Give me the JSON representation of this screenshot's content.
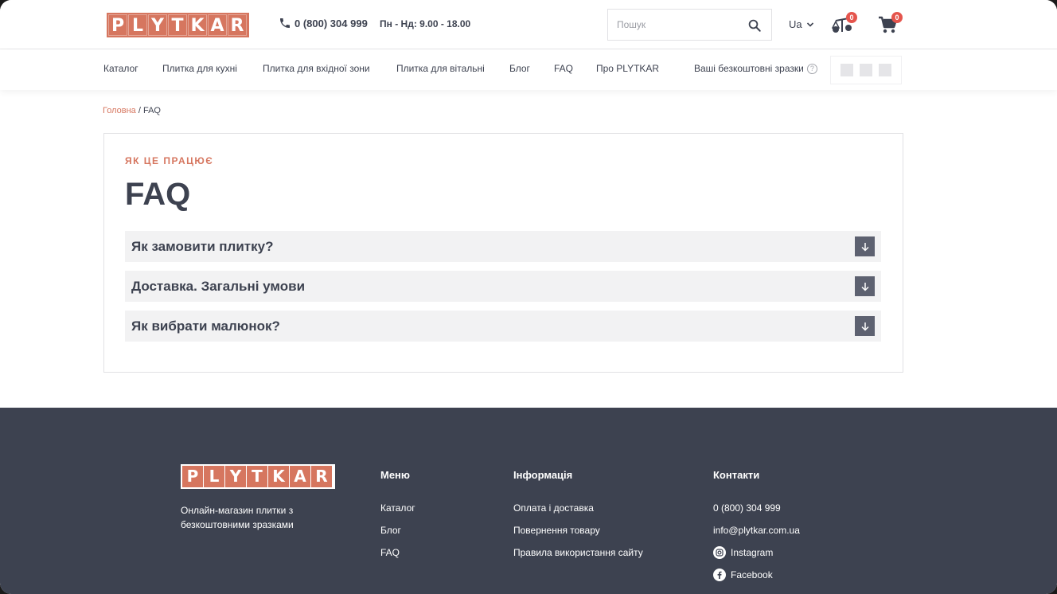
{
  "header": {
    "logo_letters": [
      "P",
      "L",
      "Y",
      "T",
      "K",
      "A",
      "R"
    ],
    "phone": "0 (800) 304 999",
    "hours": "Пн - Нд: 9.00 - 18.00",
    "search_placeholder": "Пошук",
    "lang": "Ua",
    "compare_count": "0",
    "cart_count": "0"
  },
  "nav": {
    "items": [
      "Каталог",
      "Плитка для кухні",
      "Плитка для вхідної зони",
      "Плитка для вітальні",
      "Блог",
      "FAQ",
      "Про PLYTKAR"
    ],
    "samples_label": "Ваші безкоштовні зразки",
    "help_glyph": "?"
  },
  "breadcrumb": {
    "home": "Головна",
    "separator": "/",
    "current": "FAQ"
  },
  "faq": {
    "eyebrow": "ЯК ЦЕ ПРАЦЮЄ",
    "title": "FAQ",
    "questions": [
      "Як замовити плитку?",
      "Доставка. Загальні умови",
      "Як вибрати малюнок?"
    ]
  },
  "footer": {
    "tagline": "Онлайн-магазин плитки з безкоштовними зразками",
    "menu": {
      "heading": "Меню",
      "links": [
        "Каталог",
        "Блог",
        "FAQ"
      ]
    },
    "info": {
      "heading": "Інформація",
      "links": [
        "Оплата і доставка",
        "Повернення товару",
        "Правила використання сайту"
      ]
    },
    "contacts": {
      "heading": "Контакти",
      "phone": "0 (800) 304 999",
      "email": "info@plytkar.com.ua",
      "instagram": "Instagram",
      "facebook": "Facebook"
    }
  },
  "colors": {
    "brand": "#d6765f",
    "text": "#3d4250",
    "footer_bg": "#3d4250",
    "badge": "#e5554d"
  }
}
